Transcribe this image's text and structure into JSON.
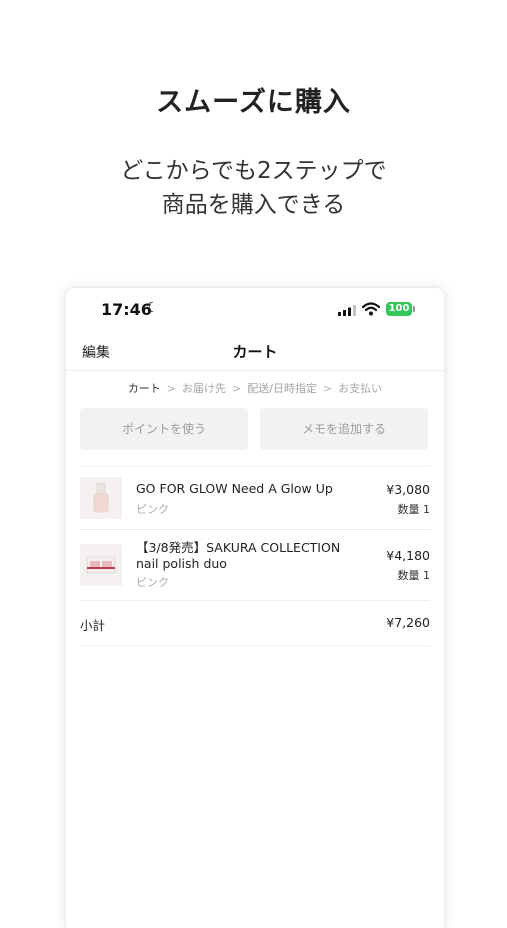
{
  "promo": {
    "headline": "スムーズに購入",
    "subline_1": "どこからでも2ステップで",
    "subline_2": "商品を購入できる"
  },
  "status_bar": {
    "time": "17:46",
    "battery": "100",
    "icons": [
      "moon-icon",
      "signal-icon",
      "wifi-icon",
      "battery-icon"
    ]
  },
  "navbar": {
    "edit_label": "編集",
    "title": "カート"
  },
  "steps": {
    "items": [
      "カート",
      "お届け先",
      "配送/日時指定",
      "お支払い"
    ],
    "separator": ">"
  },
  "actions": {
    "use_points": "ポイントを使う",
    "add_memo": "メモを追加する"
  },
  "cart_items": [
    {
      "name": "GO FOR GLOW Need A Glow Up",
      "color": "ピンク",
      "price": "¥3,080",
      "qty": "数量 1"
    },
    {
      "name": "【3/8発売】SAKURA COLLECTION nail polish duo",
      "color": "ピンク",
      "price": "¥4,180",
      "qty": "数量 1"
    }
  ],
  "subtotal": {
    "label": "小計",
    "value": "¥7,260"
  },
  "colors": {
    "battery": "#35c759",
    "button_bg": "#f2f2f4"
  }
}
